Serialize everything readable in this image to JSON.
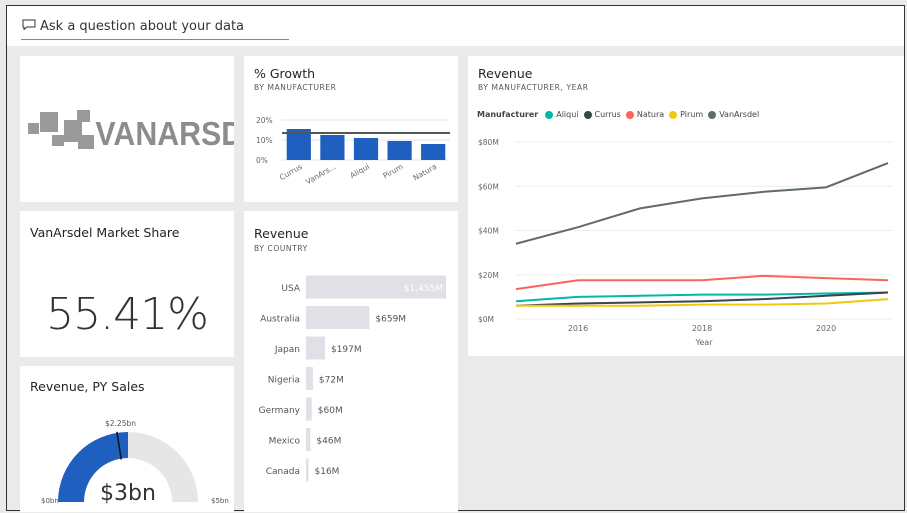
{
  "qa": {
    "placeholder": "Ask a question about your data",
    "icon": "chat-bubble-icon"
  },
  "logo": {
    "text": "VANARSDEL"
  },
  "growth": {
    "title": "% Growth",
    "subtitle": "BY MANUFACTURER",
    "ytick_labels": [
      "20%",
      "10%",
      "0%"
    ],
    "chart_data": {
      "type": "bar",
      "categories": [
        "Currus",
        "VanArs...",
        "Aliqui",
        "Pirum",
        "Natura"
      ],
      "values": [
        15.5,
        12.5,
        11,
        9.5,
        8
      ],
      "ylim": [
        0,
        20
      ],
      "reference_line": 13.5,
      "bar_color": "#1f5fbf"
    }
  },
  "market_share": {
    "title": "VanArsdel Market Share",
    "value": "55.41%"
  },
  "rev_country": {
    "title": "Revenue",
    "subtitle": "BY COUNTRY",
    "chart_data": {
      "type": "bar",
      "orientation": "horizontal",
      "categories": [
        "USA",
        "Australia",
        "Japan",
        "Nigeria",
        "Germany",
        "Mexico",
        "Canada"
      ],
      "values": [
        1455,
        659,
        197,
        72,
        60,
        46,
        16
      ],
      "labels": [
        "$1,455M",
        "$659M",
        "$197M",
        "$72M",
        "$60M",
        "$46M",
        "$16M"
      ],
      "bar_color": "#dfe1e6"
    }
  },
  "gauge": {
    "title": "Revenue, PY Sales",
    "value_label": "$3bn",
    "min_label": "$0bn",
    "max_label": "$5bn",
    "target_label": "$2.25bn",
    "chart_data": {
      "type": "gauge",
      "value": 2.5,
      "min": 0,
      "max": 5,
      "target": 2.25,
      "fill": "#1f5fbf",
      "track": "#e6e6e6"
    }
  },
  "rev_trend": {
    "title": "Revenue",
    "subtitle": "BY MANUFACTURER, YEAR",
    "legend_title": "Manufacturer",
    "xlabel": "Year",
    "ytick_labels": [
      "$80M",
      "$60M",
      "$40M",
      "$20M",
      "$0M"
    ],
    "xtick_labels": [
      "2016",
      "2018",
      "2020"
    ],
    "chart_data": {
      "type": "line",
      "x": [
        2015,
        2016,
        2017,
        2018,
        2019,
        2020,
        2021
      ],
      "ylim": [
        0,
        80
      ],
      "xlim": [
        2015,
        2021
      ],
      "series": [
        {
          "name": "Aliqui",
          "color": "#01b8aa",
          "values": [
            8,
            10,
            10.5,
            11,
            11,
            11.5,
            12
          ]
        },
        {
          "name": "Currus",
          "color": "#374649",
          "values": [
            6,
            7,
            7.5,
            8,
            9,
            10.5,
            12
          ]
        },
        {
          "name": "Natura",
          "color": "#fd625e",
          "values": [
            13.5,
            17.5,
            17.5,
            17.5,
            19.5,
            18.5,
            17.5
          ]
        },
        {
          "name": "Pirum",
          "color": "#f2c80f",
          "values": [
            6,
            6,
            6,
            6.5,
            6.5,
            7,
            9
          ]
        },
        {
          "name": "VanArsdel",
          "color": "#5f6b6d",
          "values": [
            34,
            41.5,
            50,
            54.5,
            57.5,
            59.5,
            70.5
          ]
        }
      ]
    }
  }
}
